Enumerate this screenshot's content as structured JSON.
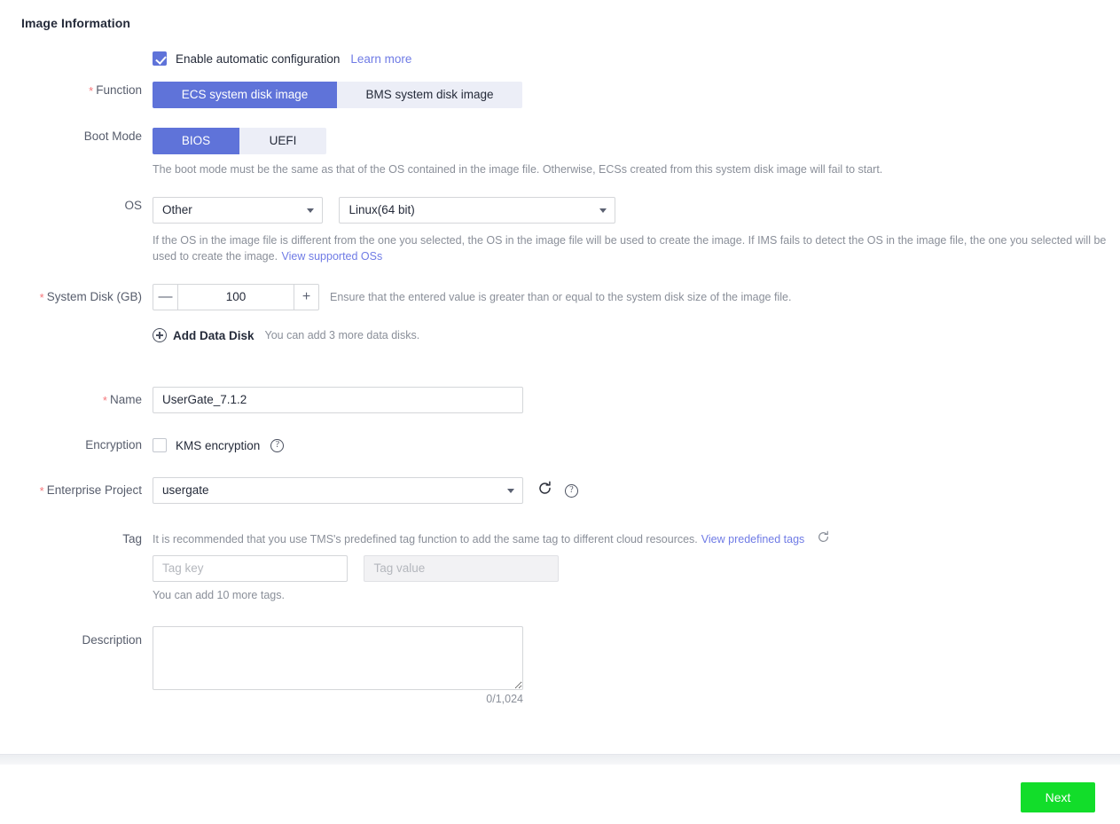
{
  "page_title": "Image Information",
  "auto_config": {
    "checked": true,
    "label": "Enable automatic configuration",
    "learn_more": "Learn more"
  },
  "function": {
    "label": "Function",
    "required": true,
    "options": [
      "ECS system disk image",
      "BMS system disk image"
    ],
    "selected": "ECS system disk image"
  },
  "boot_mode": {
    "label": "Boot Mode",
    "required": false,
    "options": [
      "BIOS",
      "UEFI"
    ],
    "selected": "BIOS",
    "hint": "The boot mode must be the same as that of the OS contained in the image file. Otherwise, ECSs created from this system disk image will fail to start."
  },
  "os": {
    "label": "OS",
    "required": false,
    "family_value": "Other",
    "version_value": "Linux(64 bit)",
    "hint": "If the OS in the image file is different from the one you selected, the OS in the image file will be used to create the image. If IMS fails to detect the OS in the image file, the one you selected will be used to create the image.",
    "hint_link": "View supported OSs"
  },
  "system_disk": {
    "label": "System Disk (GB)",
    "required": true,
    "value": "100",
    "minus": "—",
    "plus": "+",
    "hint": "Ensure that the entered value is greater than or equal to the system disk size of the image file.",
    "add_data_disk": "Add Data Disk",
    "add_data_disk_hint": "You can add 3 more data disks."
  },
  "name": {
    "label": "Name",
    "required": true,
    "value": "UserGate_7.1.2"
  },
  "encryption": {
    "label": "Encryption",
    "required": false,
    "checked": false,
    "checkbox_label": "KMS encryption",
    "help": "?"
  },
  "enterprise_project": {
    "label": "Enterprise Project",
    "required": true,
    "value": "usergate",
    "help": "?"
  },
  "tag": {
    "label": "Tag",
    "required": false,
    "hint": "It is recommended that you use TMS's predefined tag function to add the same tag to different cloud resources.",
    "hint_link": "View predefined tags",
    "key_placeholder": "Tag key",
    "value_placeholder": "Tag value",
    "key_value": "",
    "value_value": "",
    "remaining": "You can add 10 more tags."
  },
  "description": {
    "label": "Description",
    "required": false,
    "value": "",
    "counter": "0/1,024"
  },
  "footer": {
    "next_label": "Next"
  },
  "colors": {
    "accent_blue": "#5f73d9",
    "link_blue": "#6f7be5",
    "required_red": "#f5767a",
    "next_green": "#12dd2a"
  }
}
